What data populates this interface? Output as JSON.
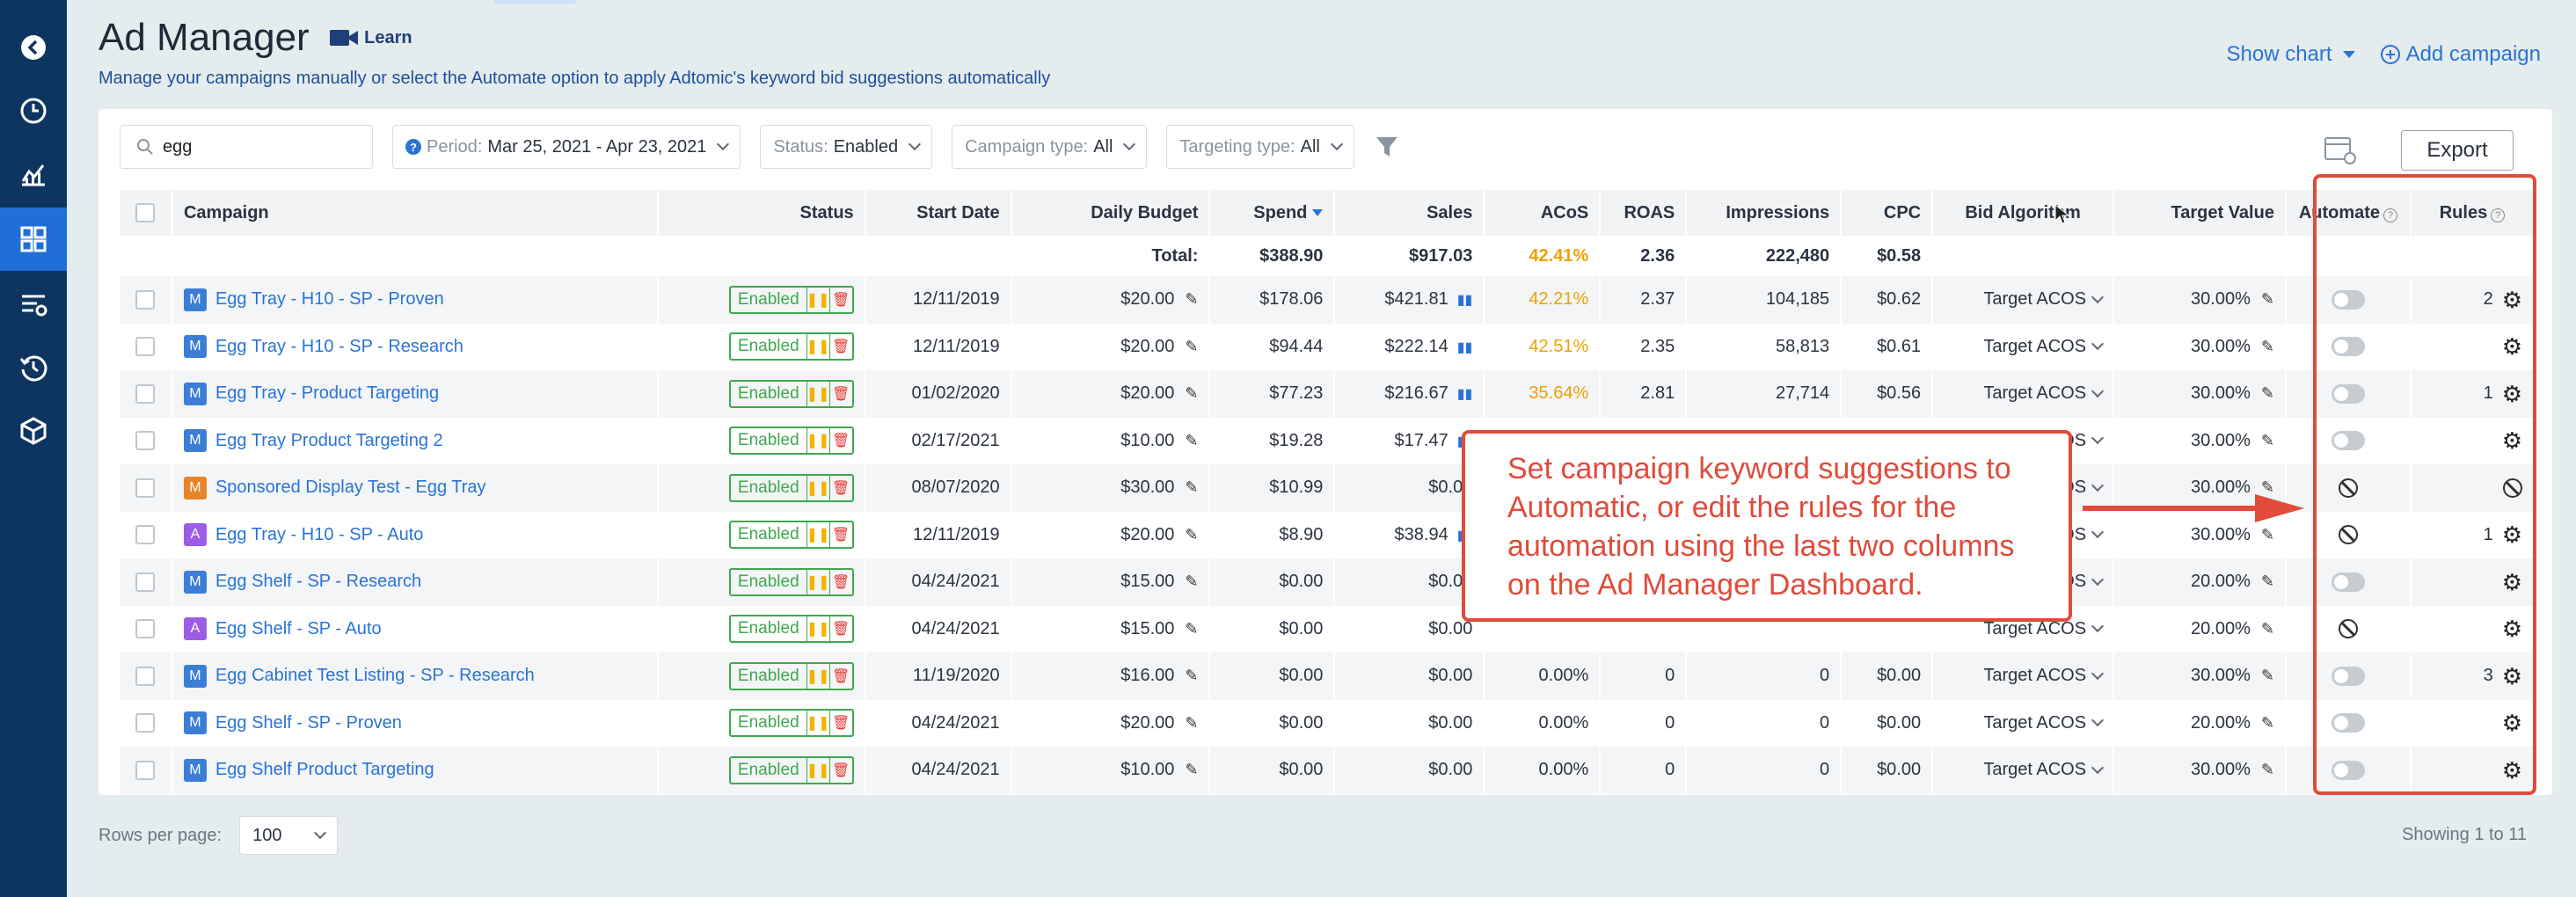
{
  "header": {
    "title": "Ad Manager",
    "learn": "Learn",
    "subtitle": "Manage your campaigns manually or select the Automate option to apply Adtomic's keyword bid suggestions automatically"
  },
  "actions": {
    "show_chart": "Show chart",
    "add_campaign": "Add campaign",
    "export": "Export"
  },
  "filters": {
    "search_value": "egg",
    "period_label": "Period:",
    "period_value": "Mar 25, 2021 - Apr 23, 2021",
    "status_label": "Status:",
    "status_value": "Enabled",
    "ctype_label": "Campaign type:",
    "ctype_value": "All",
    "ttype_label": "Targeting type:",
    "ttype_value": "All"
  },
  "columns": {
    "campaign": "Campaign",
    "status": "Status",
    "start_date": "Start Date",
    "daily_budget": "Daily Budget",
    "spend": "Spend",
    "sales": "Sales",
    "acos": "ACoS",
    "roas": "ROAS",
    "impressions": "Impressions",
    "cpc": "CPC",
    "bid_algorithm": "Bid Algorithm",
    "target_value": "Target Value",
    "automate": "Automate",
    "rules": "Rules"
  },
  "totals": {
    "label": "Total:",
    "spend": "$388.90",
    "sales": "$917.03",
    "acos": "42.41%",
    "roas": "2.36",
    "impressions": "222,480",
    "cpc": "$0.58"
  },
  "rows": [
    {
      "badge": "M",
      "badge_color": "#3c7ed6",
      "name": "Egg Tray - H10 - SP - Proven",
      "status": "Enabled",
      "start": "12/11/2019",
      "budget": "$20.00",
      "spend": "$178.06",
      "sales": "$421.81",
      "acos": "42.21%",
      "acos_hl": true,
      "roas": "2.37",
      "impr": "104,185",
      "cpc": "$0.62",
      "bid": "Target ACOS",
      "target": "30.00%",
      "automate": "toggle",
      "rules": "2",
      "chart": true
    },
    {
      "badge": "M",
      "badge_color": "#3c7ed6",
      "name": "Egg Tray - H10 - SP - Research",
      "status": "Enabled",
      "start": "12/11/2019",
      "budget": "$20.00",
      "spend": "$94.44",
      "sales": "$222.14",
      "acos": "42.51%",
      "acos_hl": true,
      "roas": "2.35",
      "impr": "58,813",
      "cpc": "$0.61",
      "bid": "Target ACOS",
      "target": "30.00%",
      "automate": "toggle",
      "rules": "",
      "chart": true
    },
    {
      "badge": "M",
      "badge_color": "#3c7ed6",
      "name": "Egg Tray - Product Targeting",
      "status": "Enabled",
      "start": "01/02/2020",
      "budget": "$20.00",
      "spend": "$77.23",
      "sales": "$216.67",
      "acos": "35.64%",
      "acos_hl": true,
      "roas": "2.81",
      "impr": "27,714",
      "cpc": "$0.56",
      "bid": "Target ACOS",
      "target": "30.00%",
      "automate": "toggle",
      "rules": "1",
      "chart": true
    },
    {
      "badge": "M",
      "badge_color": "#3c7ed6",
      "name": "Egg Tray Product Targeting 2",
      "status": "Enabled",
      "start": "02/17/2021",
      "budget": "$10.00",
      "spend": "$19.28",
      "sales": "$17.47",
      "acos": "",
      "acos_hl": false,
      "roas": "",
      "impr": "",
      "cpc": "",
      "bid": "OS",
      "target": "30.00%",
      "automate": "toggle",
      "rules": "",
      "chart": true
    },
    {
      "badge": "M",
      "badge_color": "#e8832a",
      "name": "Sponsored Display Test - Egg Tray",
      "status": "Enabled",
      "start": "08/07/2020",
      "budget": "$30.00",
      "spend": "$10.99",
      "sales": "$0.00",
      "acos": "",
      "acos_hl": false,
      "roas": "",
      "impr": "",
      "cpc": "",
      "bid": "OS",
      "target": "30.00%",
      "automate": "ban",
      "rules": "ban",
      "chart": false
    },
    {
      "badge": "A",
      "badge_color": "#9b5de5",
      "name": "Egg Tray - H10 - SP - Auto",
      "status": "Enabled",
      "start": "12/11/2019",
      "budget": "$20.00",
      "spend": "$8.90",
      "sales": "$38.94",
      "acos": "",
      "acos_hl": false,
      "roas": "",
      "impr": "",
      "cpc": "",
      "bid": "OS",
      "target": "30.00%",
      "automate": "ban",
      "rules": "1",
      "chart": true
    },
    {
      "badge": "M",
      "badge_color": "#3c7ed6",
      "name": "Egg Shelf - SP - Research",
      "status": "Enabled",
      "start": "04/24/2021",
      "budget": "$15.00",
      "spend": "$0.00",
      "sales": "$0.00",
      "acos": "",
      "acos_hl": false,
      "roas": "",
      "impr": "",
      "cpc": "",
      "bid": "OS",
      "target": "20.00%",
      "automate": "toggle",
      "rules": "",
      "chart": false
    },
    {
      "badge": "A",
      "badge_color": "#9b5de5",
      "name": "Egg Shelf - SP - Auto",
      "status": "Enabled",
      "start": "04/24/2021",
      "budget": "$15.00",
      "spend": "$0.00",
      "sales": "$0.00",
      "acos": "",
      "acos_hl": false,
      "roas": "",
      "impr": "",
      "cpc": "",
      "bid": "Target ACOS",
      "target": "20.00%",
      "automate": "ban",
      "rules": "",
      "chart": false
    },
    {
      "badge": "M",
      "badge_color": "#3c7ed6",
      "name": "Egg Cabinet Test Listing - SP - Research",
      "status": "Enabled",
      "start": "11/19/2020",
      "budget": "$16.00",
      "spend": "$0.00",
      "sales": "$0.00",
      "acos": "0.00%",
      "acos_hl": false,
      "roas": "0",
      "impr": "0",
      "cpc": "$0.00",
      "bid": "Target ACOS",
      "target": "30.00%",
      "automate": "toggle",
      "rules": "3",
      "chart": false
    },
    {
      "badge": "M",
      "badge_color": "#3c7ed6",
      "name": "Egg Shelf - SP - Proven",
      "status": "Enabled",
      "start": "04/24/2021",
      "budget": "$20.00",
      "spend": "$0.00",
      "sales": "$0.00",
      "acos": "0.00%",
      "acos_hl": false,
      "roas": "0",
      "impr": "0",
      "cpc": "$0.00",
      "bid": "Target ACOS",
      "target": "20.00%",
      "automate": "toggle",
      "rules": "",
      "chart": false
    },
    {
      "badge": "M",
      "badge_color": "#3c7ed6",
      "name": "Egg Shelf Product Targeting",
      "status": "Enabled",
      "start": "04/24/2021",
      "budget": "$10.00",
      "spend": "$0.00",
      "sales": "$0.00",
      "acos": "0.00%",
      "acos_hl": false,
      "roas": "0",
      "impr": "0",
      "cpc": "$0.00",
      "bid": "Target ACOS",
      "target": "30.00%",
      "automate": "toggle",
      "rules": "",
      "chart": false
    }
  ],
  "footer": {
    "rows_per_page_label": "Rows per page:",
    "rows_per_page_value": "100",
    "showing": "Showing 1 to 11"
  },
  "callout": {
    "text": "Set campaign keyword suggestions to Automatic, or edit the rules for the automation using the last two columns on the Ad Manager Dashboard."
  },
  "colors": {
    "accent": "#2a73d6",
    "sidebar": "#0e3460",
    "annotation": "#e04b3a",
    "enabled": "#3fa84f",
    "acos_highlight": "#f0a000"
  },
  "sidebar_icons": [
    "back-arrow-icon",
    "clock-icon",
    "analytics-icon",
    "dashboard-grid-icon",
    "list-settings-icon",
    "history-icon",
    "package-icon"
  ]
}
